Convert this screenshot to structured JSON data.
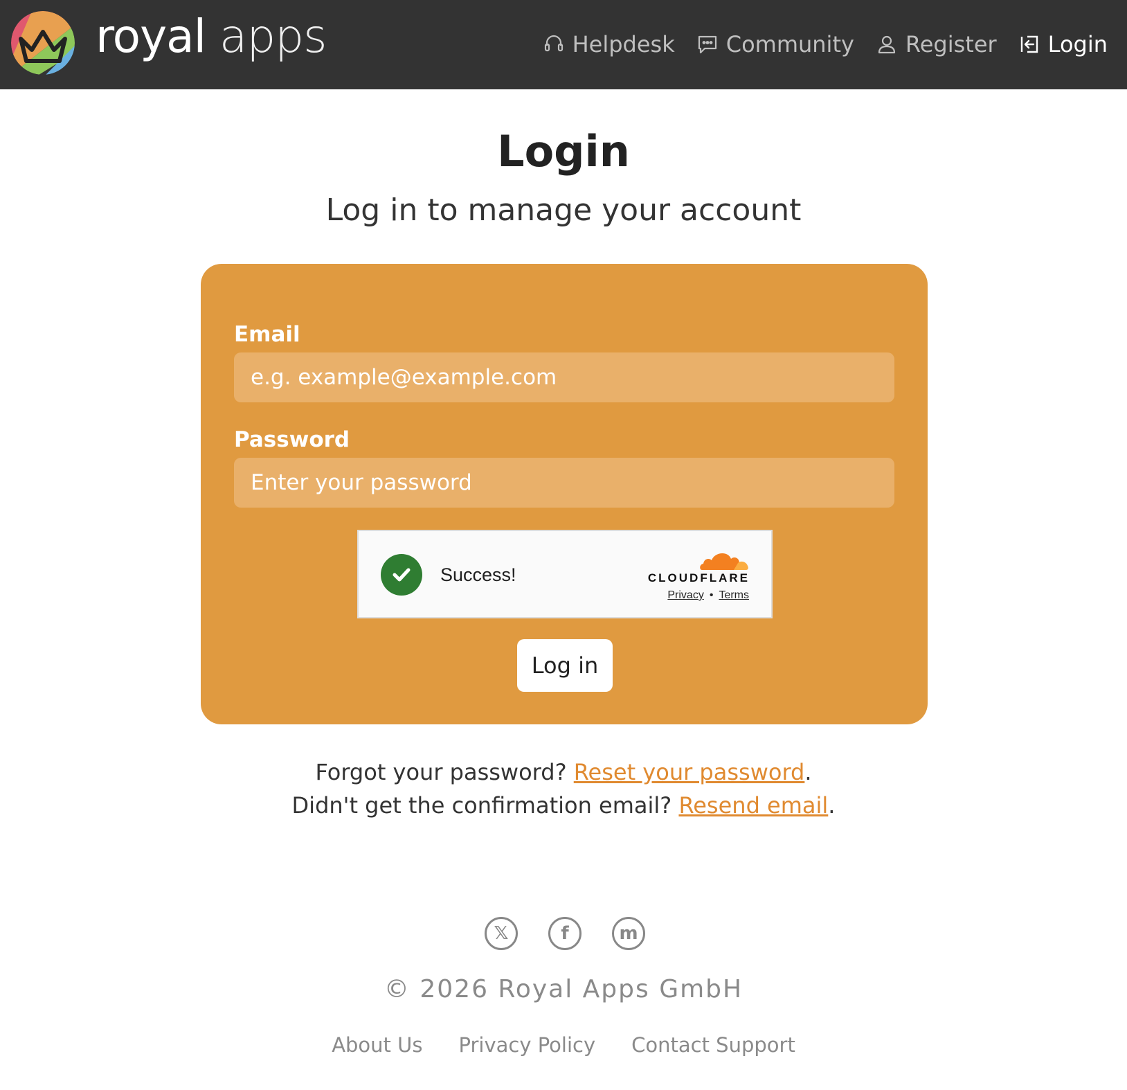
{
  "header": {
    "brand_primary": "royal",
    "brand_secondary": "apps",
    "nav": [
      {
        "label": "Helpdesk",
        "icon": "headset-icon"
      },
      {
        "label": "Community",
        "icon": "chat-icon"
      },
      {
        "label": "Register",
        "icon": "user-icon"
      },
      {
        "label": "Login",
        "icon": "login-icon"
      }
    ]
  },
  "main": {
    "title": "Login",
    "subtitle": "Log in to manage your account"
  },
  "form": {
    "email_label": "Email",
    "email_placeholder": "e.g. example@example.com",
    "password_label": "Password",
    "password_placeholder": "Enter your password",
    "submit_label": "Log in"
  },
  "captcha": {
    "status": "Success!",
    "provider": "CLOUDFLARE",
    "privacy": "Privacy",
    "separator": "•",
    "terms": "Terms"
  },
  "help": {
    "forgot_text": "Forgot your password?",
    "reset_link": "Reset your password",
    "confirm_text": "Didn't get the confirmation email?",
    "resend_link": "Resend email",
    "period": "."
  },
  "footer": {
    "social": [
      {
        "icon": "x-icon",
        "glyph": "𝕏"
      },
      {
        "icon": "facebook-icon",
        "glyph": "f"
      },
      {
        "icon": "mastodon-icon",
        "glyph": "m"
      }
    ],
    "copyright": "© 2026 Royal Apps GmbH",
    "links": [
      "About Us",
      "Privacy Policy",
      "Contact Support"
    ]
  },
  "colors": {
    "header_bg": "#333333",
    "card_bg": "#e09a40",
    "input_bg": "#e9b06a",
    "link": "#e08a30",
    "success": "#2f7d32"
  }
}
